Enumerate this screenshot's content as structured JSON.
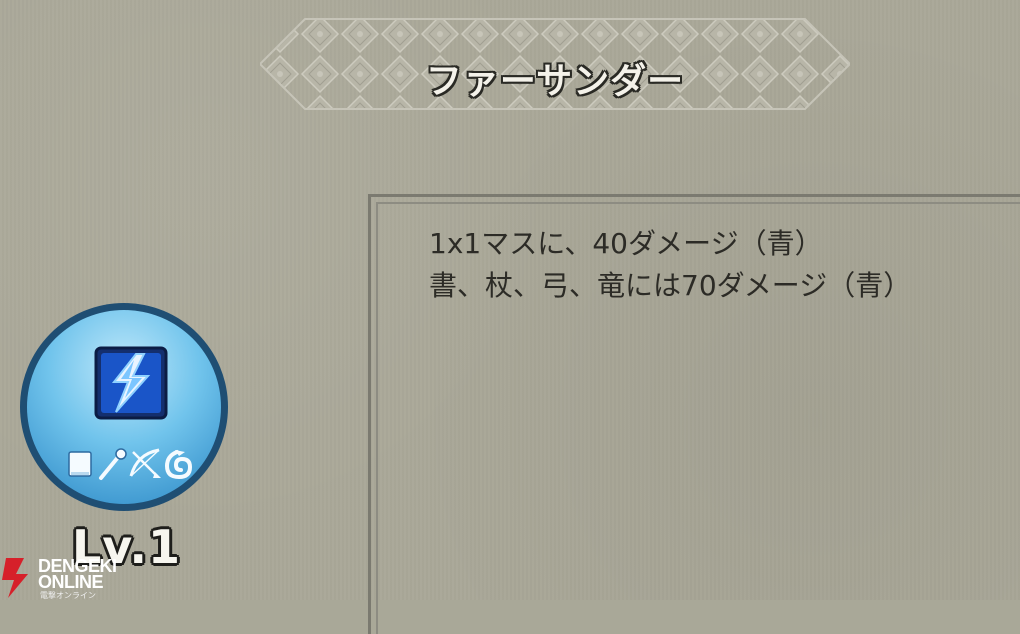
{
  "skill": {
    "name": "ファーサンダー",
    "description_lines": [
      "1x1マスに、40ダメージ（青）",
      "書、杖、弓、竜には70ダメージ（青）"
    ],
    "level_label": "Lv.1",
    "icon": "lightning-bolt-icon",
    "weapon_icons": [
      "tome-icon",
      "staff-icon",
      "bow-icon",
      "dragon-icon"
    ]
  },
  "watermark": {
    "line1": "DENGEKI",
    "line2": "ONLINE",
    "line3": "電撃オンライン"
  },
  "colors": {
    "background": "#aaa898",
    "badge_light": "#71c4ec",
    "badge_ring": "#1f4e73",
    "icon_blue": "#1a55c8",
    "watermark_red": "#d6202a"
  }
}
